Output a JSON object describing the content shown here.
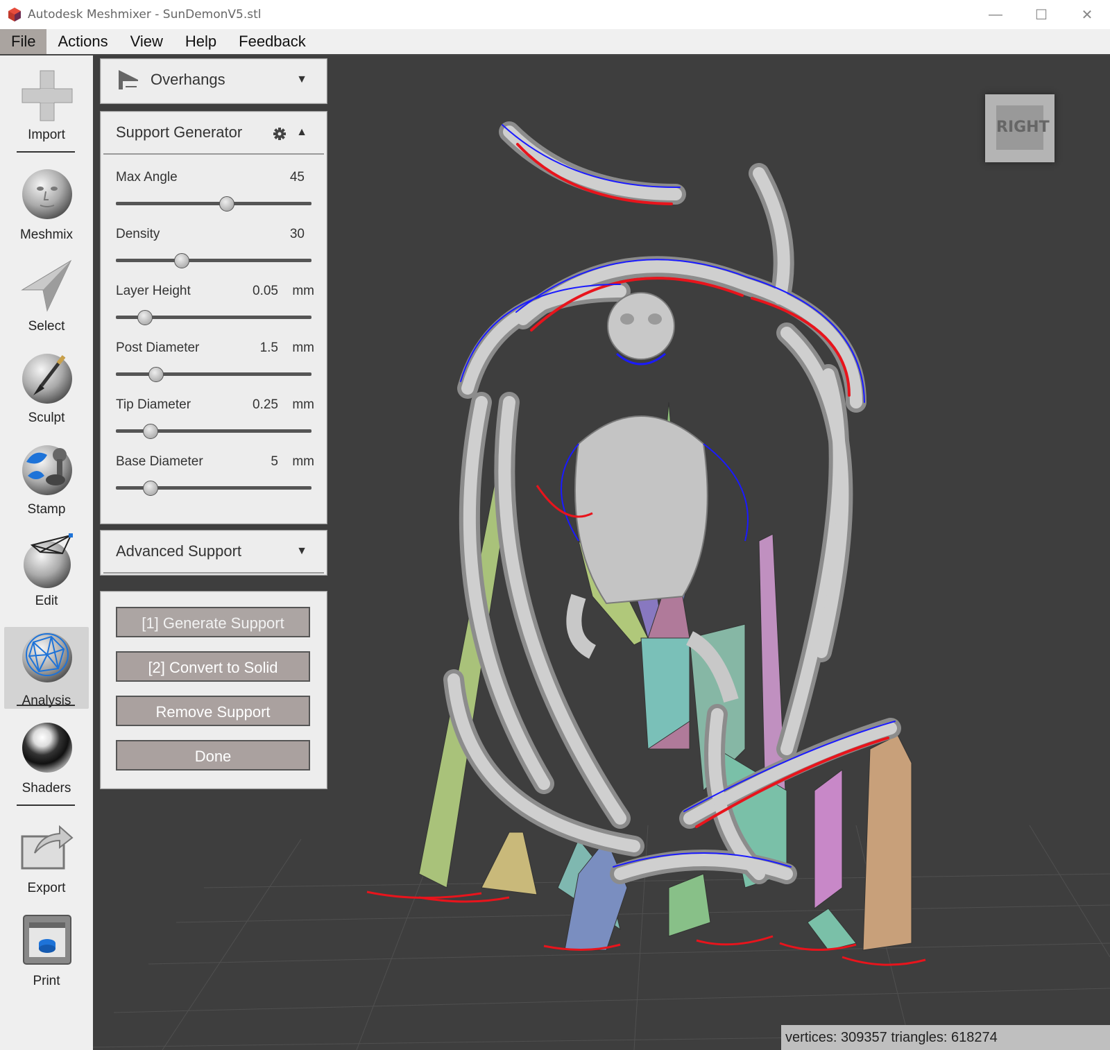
{
  "window": {
    "title": "Autodesk Meshmixer - SunDemonV5.stl",
    "minimize": "—",
    "maximize": "☐",
    "close": "✕"
  },
  "menu": [
    "File",
    "Actions",
    "View",
    "Help",
    "Feedback"
  ],
  "tools": [
    {
      "label": "Import",
      "icon": "plus-icon"
    },
    {
      "label": "Meshmix",
      "icon": "face-sphere-icon"
    },
    {
      "label": "Select",
      "icon": "arrow-cursor-icon"
    },
    {
      "label": "Sculpt",
      "icon": "brush-sphere-icon"
    },
    {
      "label": "Stamp",
      "icon": "stamp-icon"
    },
    {
      "label": "Edit",
      "icon": "wire-sphere-icon"
    },
    {
      "label": "Analysis",
      "icon": "mesh-sphere-icon",
      "selected": true
    },
    {
      "label": "Shaders",
      "icon": "chrome-sphere-icon"
    },
    {
      "label": "Export",
      "icon": "export-icon"
    },
    {
      "label": "Print",
      "icon": "printer-icon"
    }
  ],
  "overhangs": {
    "label": "Overhangs",
    "arrow": "▼"
  },
  "support_generator": {
    "label": "Support Generator",
    "arrow": "▲",
    "params": {
      "max_angle": {
        "name": "Max Angle",
        "value": "45",
        "slider": 0.57
      },
      "density": {
        "name": "Density",
        "value": "30",
        "slider": 0.32
      },
      "layer_height": {
        "name": "Layer Height",
        "value": "0.05",
        "unit": "mm",
        "slider": 0.12
      },
      "post_diameter": {
        "name": "Post Diameter",
        "value": "1.5",
        "unit": "mm",
        "slider": 0.18
      },
      "tip_diameter": {
        "name": "Tip Diameter",
        "value": "0.25",
        "unit": "mm",
        "slider": 0.15
      },
      "base_diameter": {
        "name": "Base Diameter",
        "value": "5",
        "unit": "mm",
        "slider": 0.15
      }
    }
  },
  "advanced_support": {
    "label": "Advanced Support",
    "arrow": "▼"
  },
  "actions": {
    "generate": "[1] Generate Support",
    "convert": "[2] Convert to Solid",
    "remove": "Remove Support",
    "done": "Done"
  },
  "viewcube": {
    "face": "RIGHT"
  },
  "status": {
    "text": "vertices: 309357 triangles: 618274"
  },
  "colors": {
    "viewport_bg": "#3e3e3e",
    "overhang_red": "#e8141c",
    "overhang_blue": "#1a1aff",
    "model_gray": "#c8c8c8"
  }
}
